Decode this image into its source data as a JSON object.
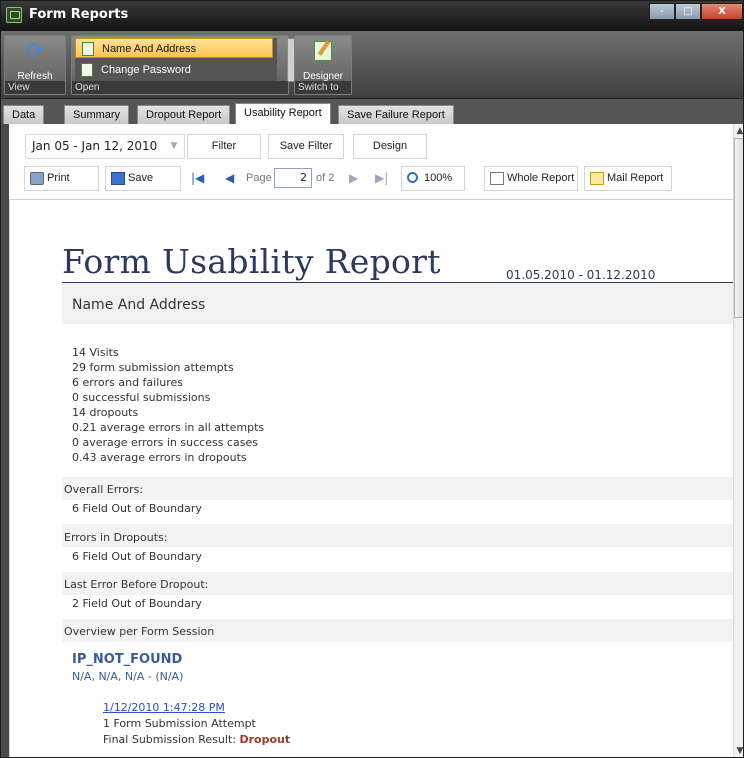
{
  "window": {
    "title": "Form Reports",
    "controls": [
      "-",
      "□",
      "X"
    ]
  },
  "ribbon": {
    "view_group": {
      "label": "View",
      "refresh_label": "Refresh"
    },
    "open_group": {
      "label": "Open",
      "items": [
        "Name And Address",
        "Change Password"
      ],
      "selected": "Name And Address"
    },
    "switch_group": {
      "label": "Switch to",
      "designer_label": "Designer"
    }
  },
  "tabs": [
    "Data",
    "Summary",
    "Dropout Report",
    "Usability Report",
    "Save Failure Report"
  ],
  "active_tab": "Usability Report",
  "toolbar": {
    "date_range": "Jan 05 - Jan 12, 2010",
    "filter": "Filter",
    "save_filter": "Save Filter",
    "design": "Design",
    "print": "Print",
    "save": "Save",
    "page_label": "Page",
    "page_current": "2",
    "page_of": "of 2",
    "zoom": "100%",
    "whole_report": "Whole Report",
    "mail_report": "Mail Report"
  },
  "report": {
    "title": "Form Usability Report",
    "range": "01.05.2010 - 01.12.2010",
    "form_name": "Name And Address",
    "stats": [
      "14 Visits",
      "29 form submission attempts",
      "6 errors and failures",
      "0 successful submissions",
      "14 dropouts",
      "0.21 average errors in all attempts",
      "0 average errors in success cases",
      "0.43 average errors in dropouts"
    ],
    "sections": [
      {
        "head": "Overall Errors:",
        "value": "6 Field Out of Boundary"
      },
      {
        "head": "Errors in Dropouts:",
        "value": "6 Field Out of Boundary"
      },
      {
        "head": "Last Error Before Dropout:",
        "value": "2 Field Out of Boundary"
      }
    ],
    "overview_head": "Overview per Form Session",
    "session": {
      "ip": "IP_NOT_FOUND",
      "location": "N/A, N/A, N/A - (N/A)",
      "timestamp": "1/12/2010 1:47:28 PM",
      "attempts": "1 Form Submission Attempt",
      "result_label": "Final Submission Result:",
      "result_value": "Dropout"
    }
  }
}
